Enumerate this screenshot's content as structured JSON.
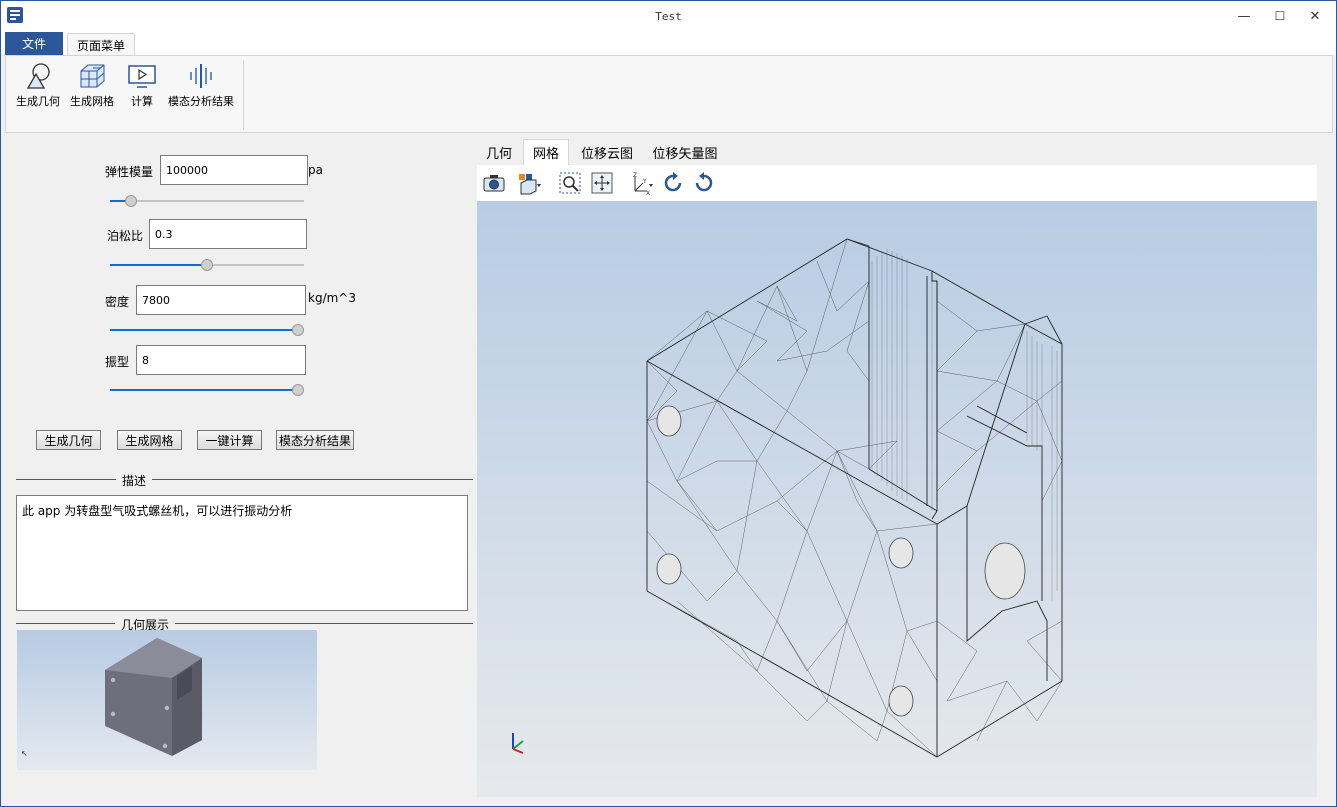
{
  "window": {
    "title": "Test"
  },
  "window_controls": {
    "minimize": "—",
    "maximize": "☐",
    "close": "✕"
  },
  "ribbon": {
    "tabs": [
      "文件",
      "页面菜单"
    ],
    "buttons": [
      {
        "label": "生成几何",
        "icon": "geometry-icon"
      },
      {
        "label": "生成网格",
        "icon": "mesh-icon"
      },
      {
        "label": "计算",
        "icon": "compute-icon"
      },
      {
        "label": "模态分析结果",
        "icon": "modal-result-icon"
      }
    ]
  },
  "params": {
    "elastic": {
      "label": "弹性模量",
      "value": "100000",
      "unit": "pa",
      "slider": 0.08
    },
    "poisson": {
      "label": "泊松比",
      "value": "0.3",
      "slider": 0.5
    },
    "density": {
      "label": "密度",
      "value": "7800",
      "unit": "kg/m^3",
      "slider": 1.0
    },
    "modes": {
      "label": "振型",
      "value": "8",
      "slider": 1.0
    }
  },
  "actions": {
    "gen_geometry": "生成几何",
    "gen_mesh": "生成网格",
    "run_all": "一键计算",
    "modal_result": "模态分析结果"
  },
  "description": {
    "title": "描述",
    "text": "此 app 为转盘型气吸式螺丝机，可以进行振动分析"
  },
  "geometry_display": {
    "title": "几何展示"
  },
  "viewer": {
    "tabs": [
      "几何",
      "网格",
      "位移云图",
      "位移矢量图"
    ],
    "active_tab": "网格",
    "toolbar": [
      "camera-icon",
      "display-mode-icon",
      "zoom-box-icon",
      "fit-all-icon",
      "axes-orientation-icon",
      "rotate-cw-icon",
      "rotate-ccw-icon"
    ]
  },
  "colors": {
    "accent": "#2b579a",
    "slider_fill": "#0a6fd8"
  }
}
